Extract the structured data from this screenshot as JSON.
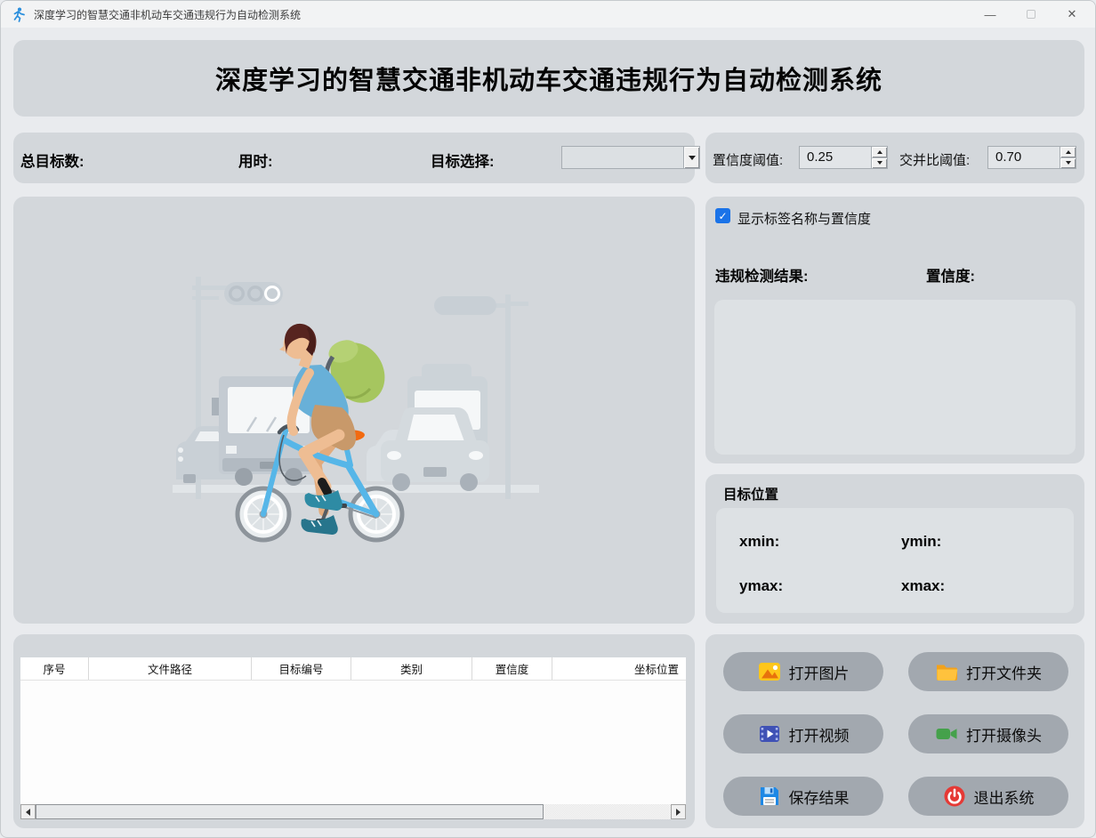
{
  "window": {
    "title": "深度学习的智慧交通非机动车交通违规行为自动检测系统",
    "minimize_glyph": "—",
    "close_glyph": "✕"
  },
  "header": {
    "title": "深度学习的智慧交通非机动车交通违规行为自动检测系统"
  },
  "info_bar": {
    "total_targets_label": "总目标数:",
    "elapsed_label": "用时:",
    "target_select_label": "目标选择:",
    "target_select_value": ""
  },
  "threshold_bar": {
    "confidence_label": "置信度阈值:",
    "confidence_value": "0.25",
    "iou_label": "交并比阈值:",
    "iou_value": "0.70"
  },
  "detection_panel": {
    "show_labels_checkbox": "显示标签名称与置信度",
    "checkbox_checked": true,
    "check_glyph": "✓",
    "result_label": "违规检测结果:",
    "confidence_label": "置信度:",
    "result_text": ""
  },
  "position_panel": {
    "title": "目标位置",
    "xmin_label": "xmin:",
    "ymin_label": "ymin:",
    "ymax_label": "ymax:",
    "xmax_label": "xmax:"
  },
  "action_buttons": [
    {
      "label": "打开图片",
      "icon": "image-icon"
    },
    {
      "label": "打开文件夹",
      "icon": "folder-icon"
    },
    {
      "label": "打开视频",
      "icon": "video-icon"
    },
    {
      "label": "打开摄像头",
      "icon": "camera-icon"
    },
    {
      "label": "保存结果",
      "icon": "save-icon"
    },
    {
      "label": "退出系统",
      "icon": "power-icon"
    }
  ],
  "results_table": {
    "columns": [
      "序号",
      "文件路径",
      "目标编号",
      "类别",
      "置信度",
      "坐标位置"
    ],
    "rows": []
  },
  "colors": {
    "accent_blue": "#1a73e8",
    "panel_gray": "#d3d7db",
    "button_gray": "#a2a8af",
    "window_bg": "#e9ebee",
    "bike_blue": "#56b6e8",
    "backpack_green": "#a6c65f",
    "saddle_orange": "#f26a10"
  }
}
